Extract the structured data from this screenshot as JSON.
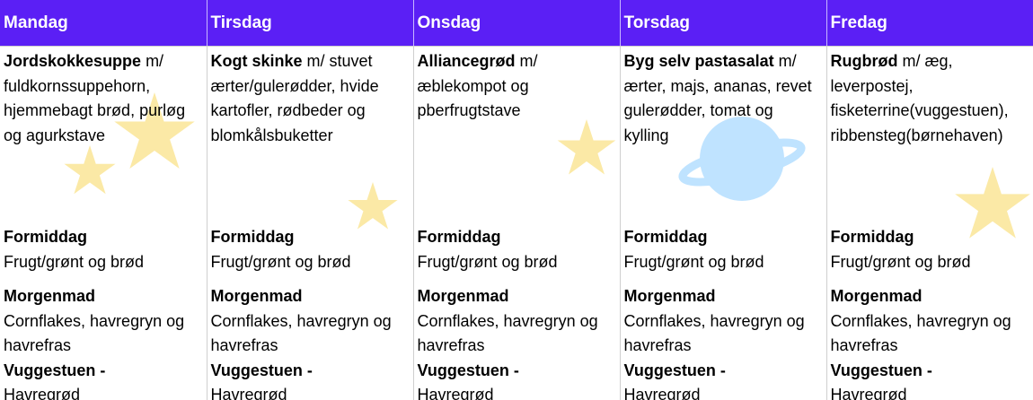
{
  "days": [
    {
      "name": "Mandag",
      "lunch": {
        "dish": "Jordskokkesuppe",
        "rest": " m/ fuldkornssuppehorn, hjemmebagt brød, purløg og agurkstave"
      },
      "snack": {
        "heading": "Formiddag",
        "text": "Frugt/grønt og brød"
      },
      "breakfast": {
        "heading": "Morgenmad",
        "text": "Cornflakes, havregryn og havrefras"
      },
      "nursery": {
        "heading": "Vuggestuen -",
        "text": "Havregrød"
      }
    },
    {
      "name": "Tirsdag",
      "lunch": {
        "dish": "Kogt skinke",
        "rest": " m/ stuvet ærter/gulerødder, hvide kartofler, rødbeder og blomkålsbuketter"
      },
      "snack": {
        "heading": "Formiddag",
        "text": "Frugt/grønt og brød"
      },
      "breakfast": {
        "heading": "Morgenmad",
        "text": "Cornflakes, havregryn og havrefras"
      },
      "nursery": {
        "heading": "Vuggestuen -",
        "text": "Havregrød"
      }
    },
    {
      "name": "Onsdag",
      "lunch": {
        "dish": "Alliancegrød",
        "rest": " m/ æblekompot og pberfrugtstave"
      },
      "snack": {
        "heading": "Formiddag",
        "text": "Frugt/grønt og brød"
      },
      "breakfast": {
        "heading": "Morgenmad",
        "text": "Cornflakes, havregryn og havrefras"
      },
      "nursery": {
        "heading": "Vuggestuen -",
        "text": "Havregrød"
      }
    },
    {
      "name": "Torsdag",
      "lunch": {
        "dish": "Byg selv pastasalat",
        "rest": " m/ ærter, majs, ananas, revet gulerødder, tomat og kylling"
      },
      "snack": {
        "heading": "Formiddag",
        "text": "Frugt/grønt og brød"
      },
      "breakfast": {
        "heading": "Morgenmad",
        "text": "Cornflakes, havregryn og havrefras"
      },
      "nursery": {
        "heading": "Vuggestuen -",
        "text": "Havregrød"
      }
    },
    {
      "name": "Fredag",
      "lunch": {
        "dish": "Rugbrød",
        "rest": " m/ æg, leverpostej, fisketerrine(vuggestuen), ribbensteg(børnehaven)"
      },
      "snack": {
        "heading": "Formiddag",
        "text": "Frugt/grønt og brød"
      },
      "breakfast": {
        "heading": "Morgenmad",
        "text": "Cornflakes, havregryn og havrefras"
      },
      "nursery": {
        "heading": "Vuggestuen -",
        "text": "Havregrød"
      }
    }
  ],
  "colors": {
    "header_bg": "#5b1ff5",
    "header_text": "#ffffff",
    "star": "#fbe9a6",
    "planet": "#bfe3ff"
  },
  "decorations": [
    "star-icon",
    "planet-icon"
  ]
}
